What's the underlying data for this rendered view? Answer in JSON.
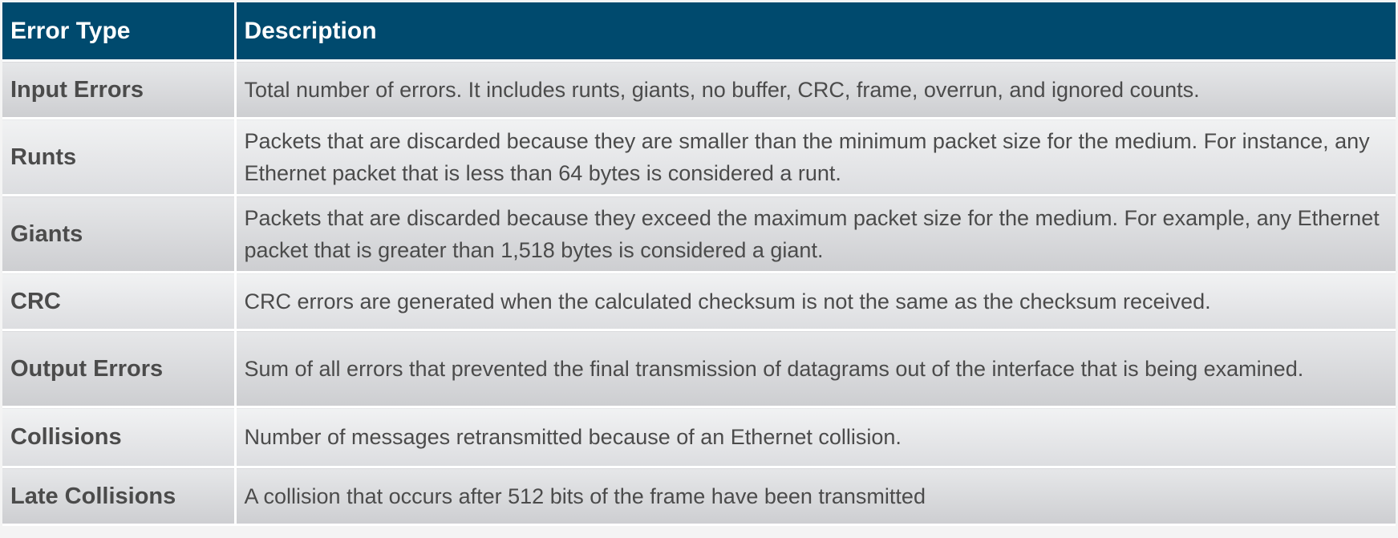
{
  "header": {
    "col1": "Error Type",
    "col2": "Description"
  },
  "rows": [
    {
      "type": "Input Errors",
      "description": "Total number of errors. It includes runts, giants, no buffer, CRC, frame, overrun, and ignored counts."
    },
    {
      "type": "Runts",
      "description": "Packets that are discarded because they are smaller than the minimum packet size for the medium. For instance, any Ethernet packet that is less than 64 bytes is considered a runt."
    },
    {
      "type": "Giants",
      "description": "Packets that are discarded because they exceed the maximum packet size for the medium. For example, any Ethernet packet that is greater than 1,518 bytes is considered a giant."
    },
    {
      "type": "CRC",
      "description": "CRC errors are generated when the calculated checksum is not the same as the checksum received."
    },
    {
      "type": "Output Errors",
      "description": "Sum of all errors that prevented the final transmission of datagrams out of the interface that is being examined."
    },
    {
      "type": "Collisions",
      "description": "Number of messages retransmitted because of an Ethernet collision."
    },
    {
      "type": "Late Collisions",
      "description": "A collision that occurs after 512 bits of the frame have been transmitted"
    }
  ],
  "colors": {
    "header_bg": "#004a6e",
    "header_text": "#ffffff",
    "body_text": "#4b4b4b"
  }
}
